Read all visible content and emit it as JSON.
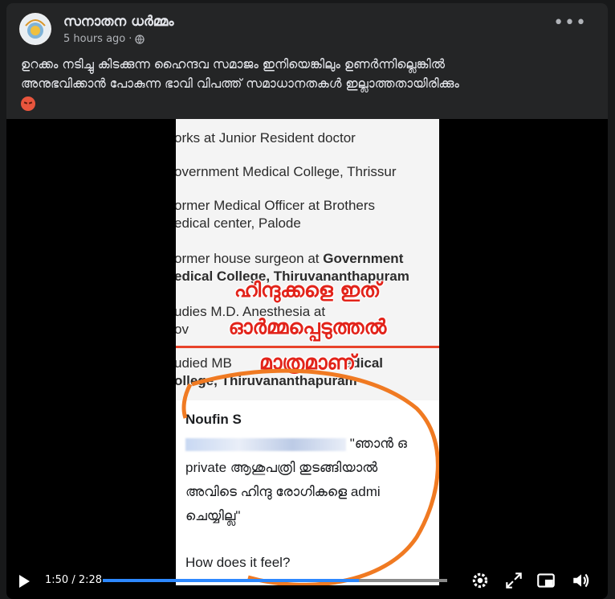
{
  "post": {
    "author": "സനാതന ധർമ്മം",
    "time": "5 hours ago",
    "privacy_icon": "globe-icon",
    "more_icon": "more-options-icon",
    "caption_line1": "ഉറക്കം നടിച്ചു കിടക്കുന്ന ഹൈന്ദവ സമാജം ഇനിയെങ്കിലും ഉണർന്നില്ലെങ്കിൽ",
    "caption_line2": "അനുഭവിക്കാൻ പോകുന്ന ഭാവി വിപത്ത് സമാധാനതകൾ ഇല്ലാത്തതായിരിക്കും",
    "caption_emoji": "angry-face-emoji"
  },
  "video": {
    "doc_lines": [
      "orks at Junior Resident doctor",
      "overnment Medical College, Thrissur",
      "ormer Medical Officer at Brothers",
      "edical center, Palode",
      "ormer house surgeon at ",
      "Government",
      "edical College, Thiruvananthapuram",
      "udies M.D. Anesthesia at",
      "ov",
      "udied MB",
      "edical",
      "ollege, Thiruvananthapuram"
    ],
    "overlay_line1": "ഹിന്ദുക്കളെ ഇത്",
    "overlay_line2": "ഓർമ്മപ്പെടുത്തൽ",
    "overlay_line3": "മാത്രമാണ്",
    "card_name": "Noufin S",
    "card_line1": "\"ഞാൻ ഒ",
    "card_line2": "private ആശുപത്രി തുടങ്ങിയാൽ",
    "card_line3": "അവിടെ ഹിന്ദു രോഗികളെ admi",
    "card_line4": "ചെയ്യില്ല\"",
    "card_line5": "How does it feel?"
  },
  "player": {
    "time_display": "1:50 / 2:28",
    "progress": 0.743,
    "accent": "#2d88ff",
    "icons": [
      "play-icon",
      "settings-icon",
      "fullscreen-icon",
      "pip-icon",
      "volume-icon"
    ]
  }
}
